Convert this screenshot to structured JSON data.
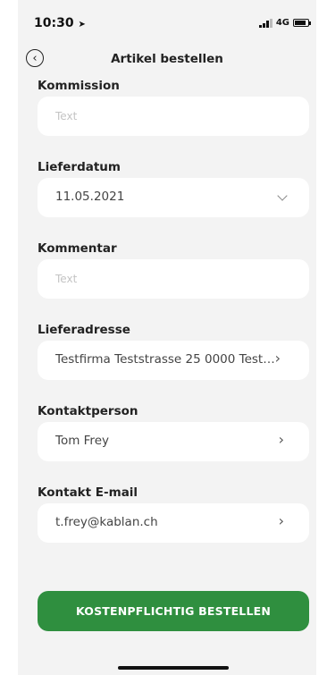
{
  "status_bar": {
    "time": "10:30",
    "network": "4G"
  },
  "nav": {
    "title": "Artikel bestellen"
  },
  "form": {
    "kommission": {
      "label": "Kommission",
      "placeholder": "Text"
    },
    "lieferdatum": {
      "label": "Lieferdatum",
      "value": "11.05.2021"
    },
    "kommentar": {
      "label": "Kommentar",
      "placeholder": "Text"
    },
    "lieferadresse": {
      "label": "Lieferadresse",
      "value": "Testfirma Teststrasse 25 0000 Test…"
    },
    "kontaktperson": {
      "label": "Kontaktperson",
      "value": "Tom Frey"
    },
    "kontakt_email": {
      "label": "Kontakt E-mail",
      "value": "t.frey@kablan.ch"
    }
  },
  "cta": {
    "label": "KOSTENPFLICHTIG BESTELLEN"
  },
  "icons": [
    "back-icon",
    "chevron-down-icon",
    "chevron-right-icon",
    "location-arrow-icon",
    "signal-icon",
    "battery-icon"
  ],
  "colors": {
    "accent": "#2f8f3f",
    "background": "#f3f3f3"
  }
}
